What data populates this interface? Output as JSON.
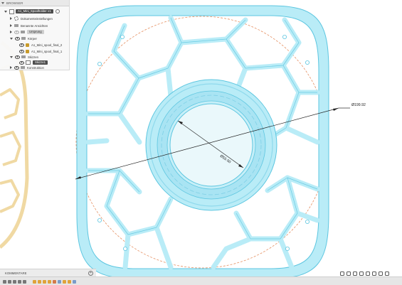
{
  "browser": {
    "header": "BROWSER",
    "root": "A1_Mini_Spoolholder v1",
    "items": [
      {
        "label": "Dokumenteinstellungen"
      },
      {
        "label": "Benannte Ansichten"
      },
      {
        "label": "Ursprung"
      },
      {
        "label": "Körper"
      },
      {
        "label": "A1_Mini_spool_final_2"
      },
      {
        "label": "A1_Mini_spool_final_1"
      },
      {
        "label": "Skizzen"
      },
      {
        "label": "Skizze1"
      },
      {
        "label": "Konstruktion"
      }
    ]
  },
  "dimensions": {
    "outer": "Ø199.92",
    "inner": "Ø55.00"
  },
  "comments": {
    "label": "KOMMENTARE"
  },
  "colors": {
    "part_fill": "#b9ecf7",
    "part_stroke": "#5dc6e0",
    "other_part": "#f3dca8",
    "dashed_circle": "#e58f60"
  },
  "icons": [
    "eye-icon",
    "gear-icon",
    "folder-icon",
    "component-icon",
    "sketch-icon",
    "orbit-icon",
    "pan-icon",
    "zoom-icon",
    "display-settings-icon",
    "grid-icon",
    "viewports-icon"
  ]
}
